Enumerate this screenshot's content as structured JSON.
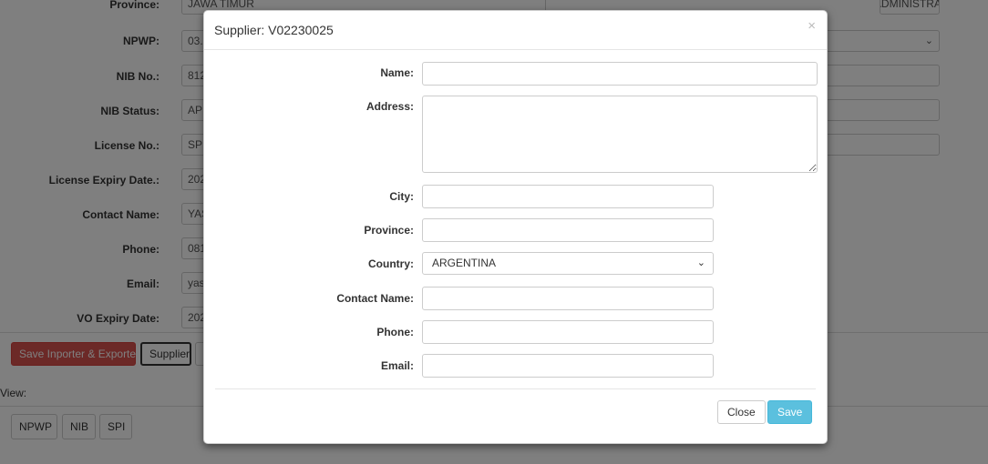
{
  "background": {
    "top_province_label": "Province:",
    "top_province_value": "JAWA TIMUR",
    "top_right_value": "SPECIAL ADMINISTRATIVE BANGKOK",
    "fields": [
      {
        "label": "NPWP:",
        "value": "03."
      },
      {
        "label": "NIB No.:",
        "value": "812"
      },
      {
        "label": "NIB Status:",
        "value": "AP"
      },
      {
        "label": "License No.:",
        "value": "SP"
      },
      {
        "label": "License Expiry Date.:",
        "value": "202"
      },
      {
        "label": "Contact Name:",
        "value": "YAS"
      },
      {
        "label": "Phone:",
        "value": "081"
      },
      {
        "label": "Email:",
        "value": "yas"
      },
      {
        "label": "VO Expiry Date:",
        "value": "202"
      }
    ],
    "save_importer_exporter_label": "Save Inporter & Exporter",
    "supplier_label": "Supplier",
    "view_label": "View:",
    "view_buttons": [
      "NPWP",
      "NIB",
      "SPI"
    ]
  },
  "modal": {
    "title": "Supplier: V02230025",
    "close_symbol": "×",
    "labels": {
      "name": "Name:",
      "address": "Address:",
      "city": "City:",
      "province": "Province:",
      "country": "Country:",
      "contact_name": "Contact Name:",
      "phone": "Phone:",
      "email": "Email:"
    },
    "values": {
      "name": "",
      "address": "",
      "city": "",
      "province": "",
      "country": "ARGENTINA",
      "contact_name": "",
      "phone": "",
      "email": ""
    },
    "close_label": "Close",
    "save_label": "Save"
  }
}
